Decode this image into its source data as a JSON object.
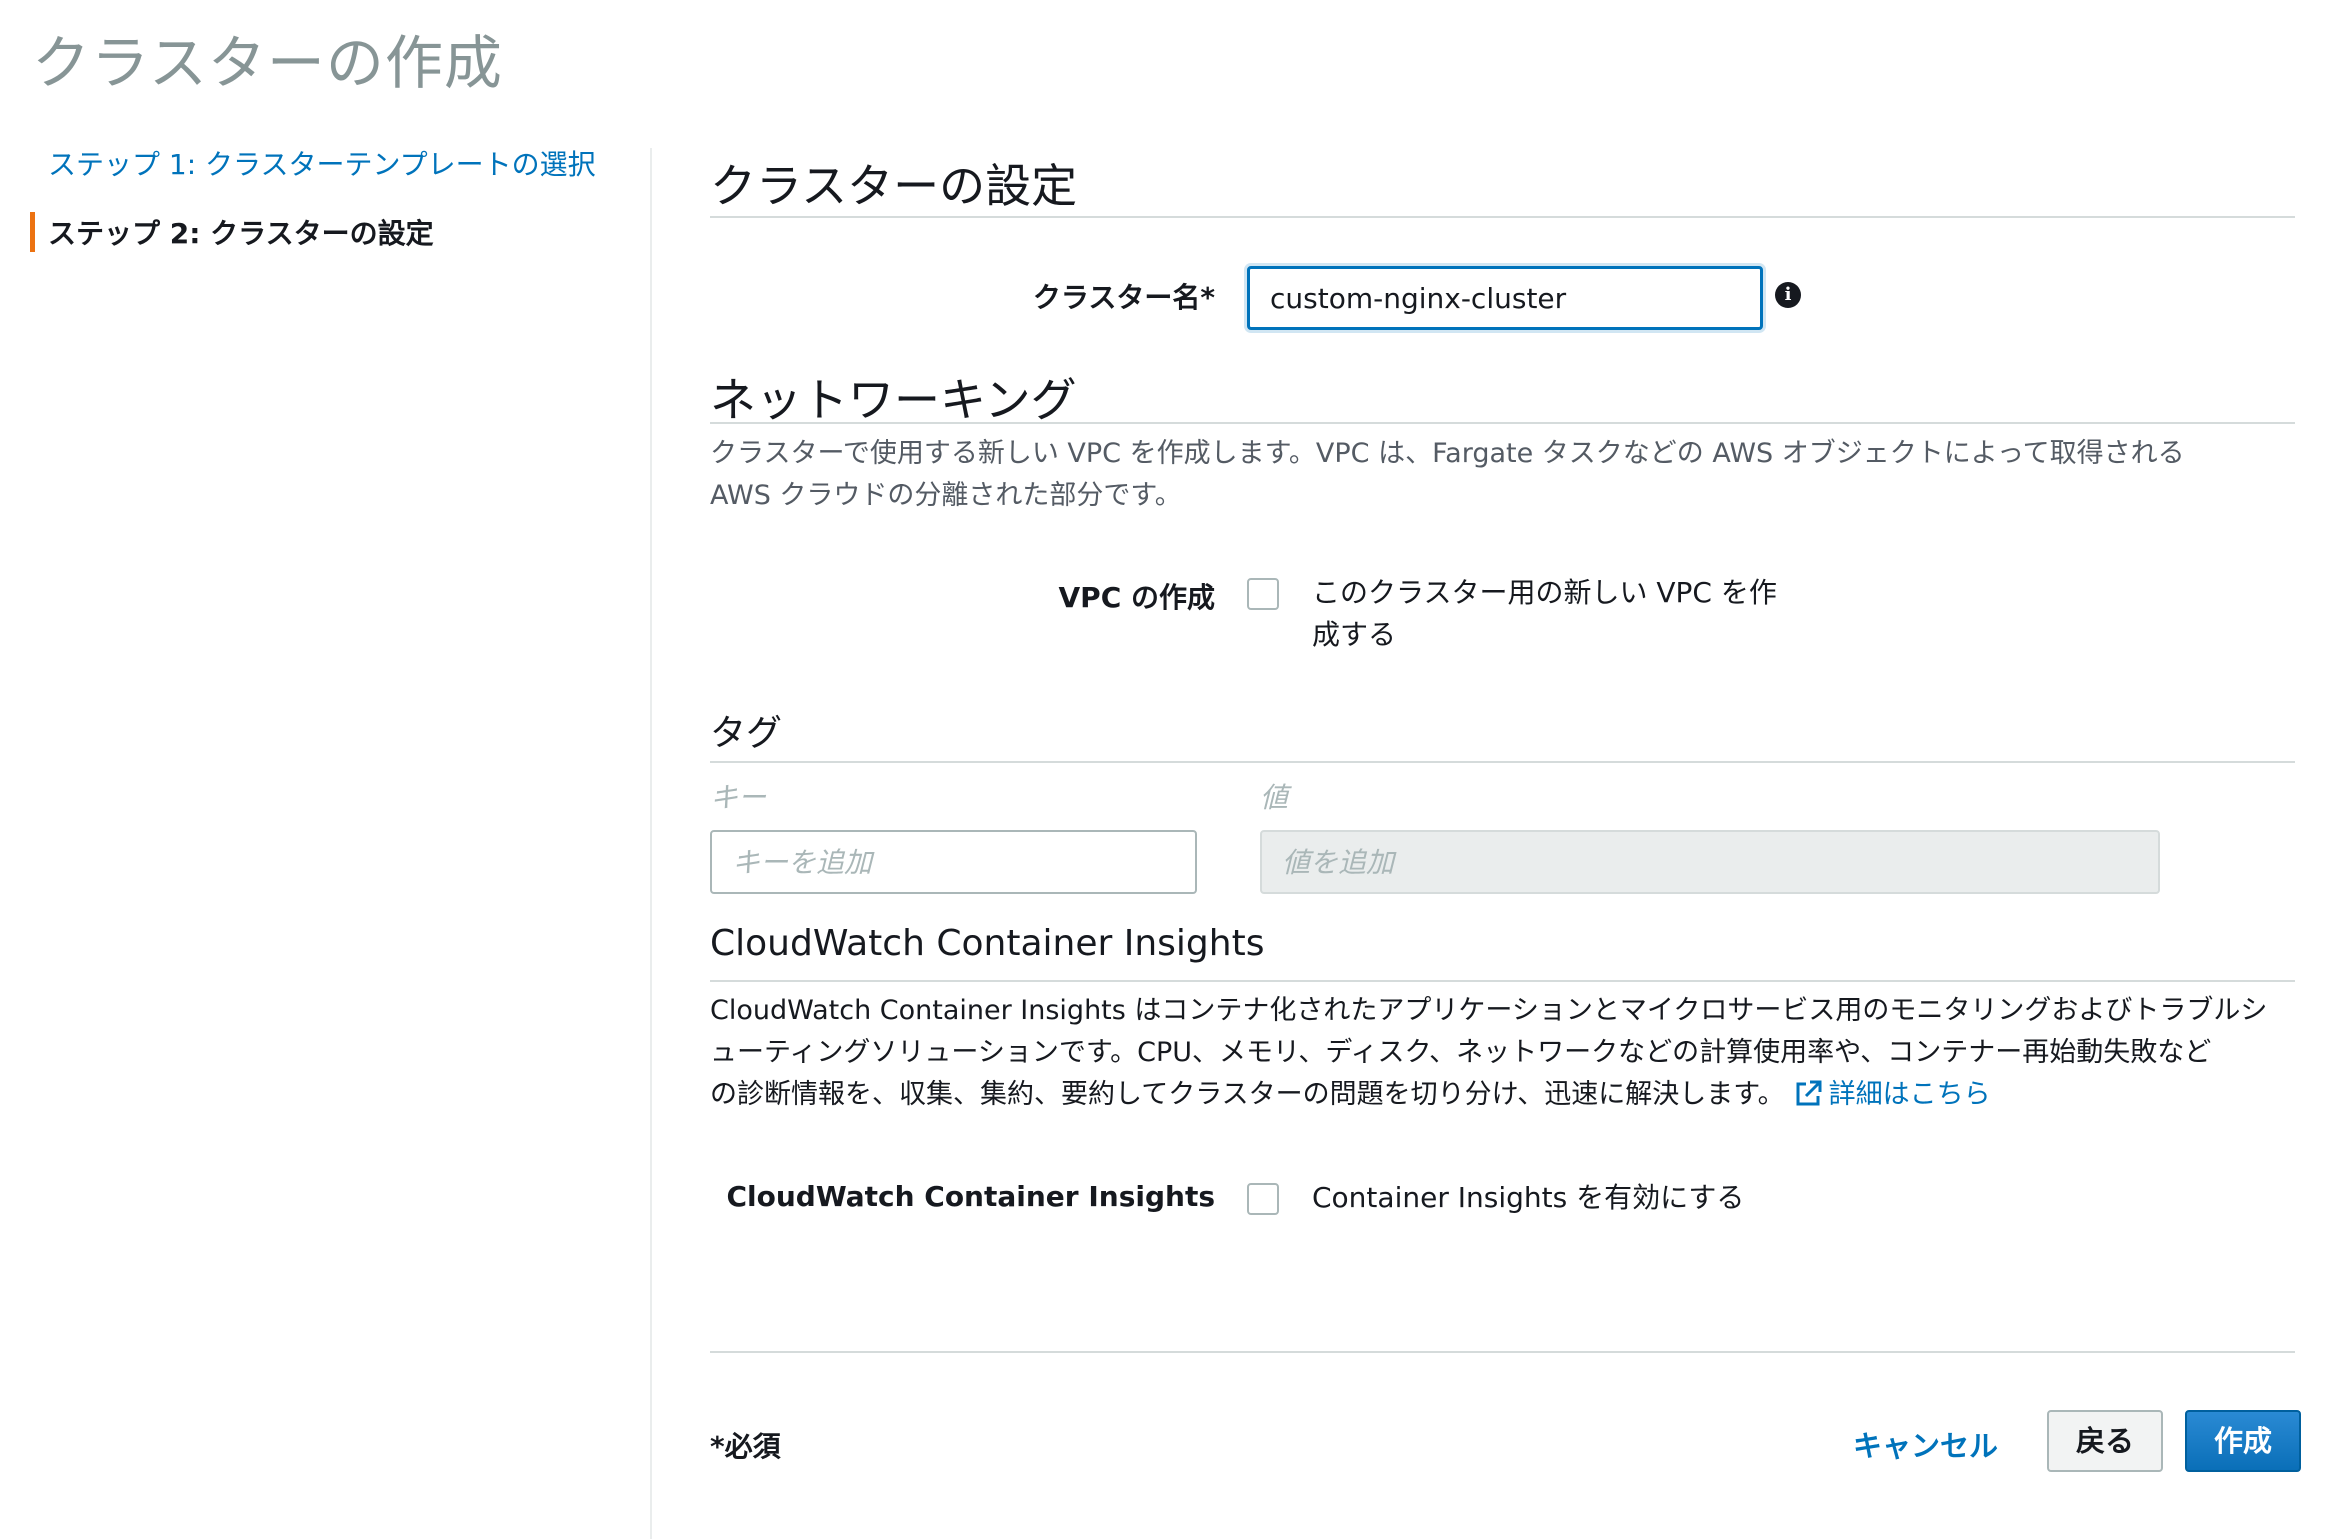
{
  "page": {
    "title": "クラスターの作成"
  },
  "sidebar": {
    "steps": [
      {
        "label": "ステップ 1: クラスターテンプレートの選択",
        "active": false
      },
      {
        "label": "ステップ 2: クラスターの設定",
        "active": true
      }
    ],
    "active_accent": "#ec7211"
  },
  "cluster_config": {
    "heading": "クラスターの設定",
    "name_label": "クラスター名*",
    "name_value": "custom-nginx-cluster"
  },
  "networking": {
    "heading": "ネットワーキング",
    "description_line1": "クラスターで使用する新しい VPC を作成します。VPC は、Fargate タスクなどの AWS オブジェクトによって取得される",
    "description_line2": "AWS クラウドの分離された部分です。",
    "vpc_label": "VPC の作成",
    "vpc_checkbox_line1": "このクラスター用の新しい VPC を作",
    "vpc_checkbox_line2": "成する",
    "vpc_checked": false
  },
  "tags": {
    "heading": "タグ",
    "key_column": "キー",
    "value_column": "値",
    "key_placeholder": "キーを追加",
    "value_placeholder": "値を追加"
  },
  "insights": {
    "heading": "CloudWatch Container Insights",
    "description_line1": "CloudWatch Container Insights はコンテナ化されたアプリケーションとマイクロサービス用のモニタリングおよびトラブルシ",
    "description_line2": "ューティングソリューションです。CPU、メモリ、ディスク、ネットワークなどの計算使用率や、コンテナー再始動失敗など",
    "description_line3": "の診断情報を、収集、集約、要約してクラスターの問題を切り分け、迅速に解決します。",
    "learn_more": "詳細はこちら",
    "field_label": "CloudWatch Container Insights",
    "checkbox_label": "Container Insights を有効にする",
    "checked": false
  },
  "footer": {
    "required_note": "*必須",
    "cancel": "キャンセル",
    "back": "戻る",
    "create": "作成"
  },
  "colors": {
    "link": "#0073bb",
    "primary_button": "#0073bb",
    "muted_text": "#545b64"
  }
}
